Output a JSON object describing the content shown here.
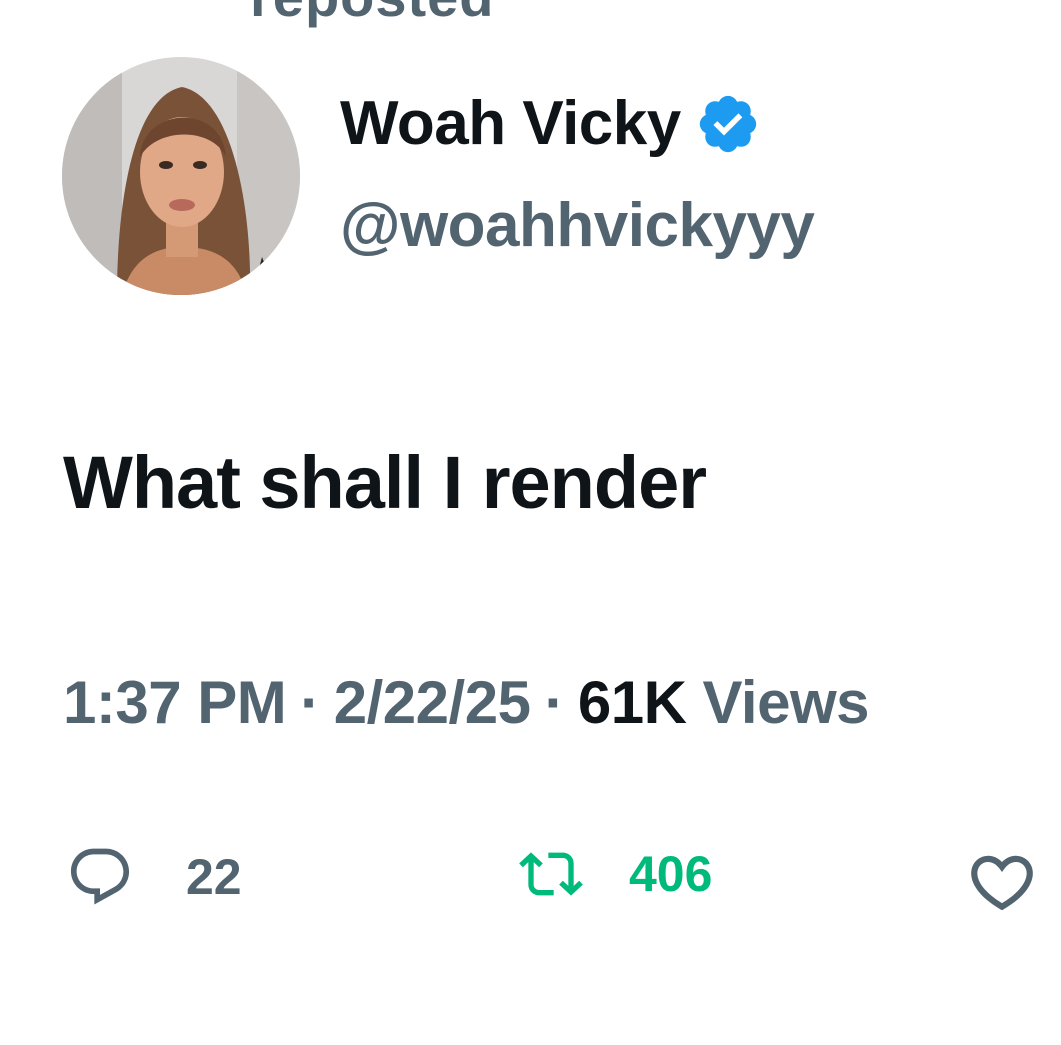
{
  "top_cutoff_text": "reposted",
  "author": {
    "display_name": "Woah Vicky",
    "handle": "@woahhvickyyy",
    "verified": true,
    "verified_icon": "verified-badge-icon",
    "verified_color": "#1d9bf0"
  },
  "tweet": {
    "text": "What shall I render"
  },
  "meta": {
    "time": "1:37 PM",
    "separator": "·",
    "date": "2/22/25",
    "views_count": "61K",
    "views_label": "Views"
  },
  "actions": {
    "reply": {
      "icon": "reply-icon",
      "count": "22"
    },
    "retweet": {
      "icon": "retweet-icon",
      "count": "406",
      "color": "#00ba7c"
    },
    "like": {
      "icon": "heart-icon"
    }
  },
  "colors": {
    "primary_text": "#0f1419",
    "secondary_text": "#536471",
    "background": "#ffffff"
  }
}
